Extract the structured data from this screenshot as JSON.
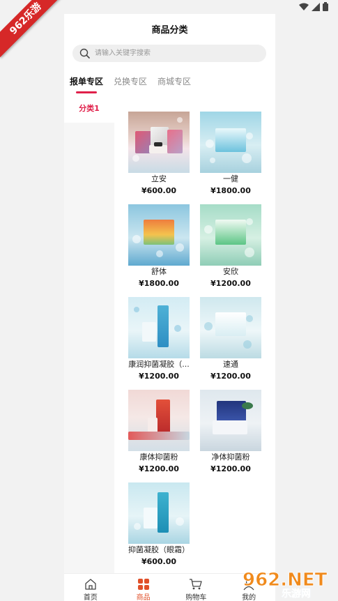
{
  "watermark_top": "962乐游",
  "watermark_bottom": {
    "main": "962.NET",
    "sub": "乐游网"
  },
  "header": {
    "title": "商品分类"
  },
  "search": {
    "placeholder": "请输入关键字搜索",
    "icon": "search-icon"
  },
  "tabs": [
    {
      "label": "报单专区",
      "active": true
    },
    {
      "label": "兑换专区",
      "active": false
    },
    {
      "label": "商城专区",
      "active": false
    }
  ],
  "categories": [
    {
      "label": "分类1",
      "active": true
    }
  ],
  "products": [
    {
      "name": "立安",
      "price": "¥600.00"
    },
    {
      "name": "一健",
      "price": "¥1800.00"
    },
    {
      "name": "舒体",
      "price": "¥1800.00"
    },
    {
      "name": "安欣",
      "price": "¥1200.00"
    },
    {
      "name": "康润抑菌凝胶（...",
      "price": "¥1200.00"
    },
    {
      "name": "速通",
      "price": "¥1200.00"
    },
    {
      "name": "康体抑菌粉",
      "price": "¥1200.00"
    },
    {
      "name": "净体抑菌粉",
      "price": "¥1200.00"
    },
    {
      "name": "抑菌凝胶（眼霜）",
      "price": "¥600.00"
    }
  ],
  "bottom_nav": [
    {
      "label": "首页",
      "icon": "home-icon",
      "active": false
    },
    {
      "label": "商品",
      "icon": "grid-icon",
      "active": true
    },
    {
      "label": "购物车",
      "icon": "cart-icon",
      "active": false
    },
    {
      "label": "我的",
      "icon": "user-icon",
      "active": false
    }
  ],
  "colors": {
    "accent": "#e0204a",
    "nav_active": "#e0502a",
    "background": "#f2f2f2"
  }
}
